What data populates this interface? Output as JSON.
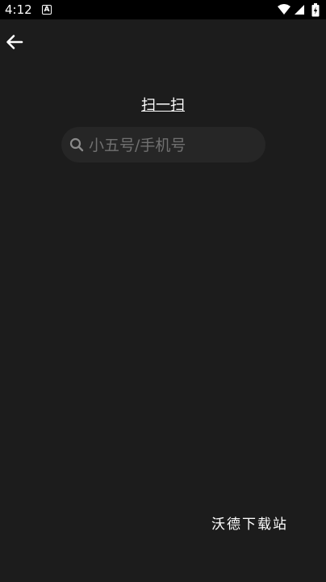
{
  "status_bar": {
    "time": "4:12",
    "notification_icon": "a-icon"
  },
  "header": {
    "back_icon": "arrow-left-icon"
  },
  "scan_link": {
    "label": "扫一扫"
  },
  "search": {
    "placeholder": "小五号/手机号",
    "value": ""
  },
  "footer": {
    "watermark": "沃德下载站"
  }
}
